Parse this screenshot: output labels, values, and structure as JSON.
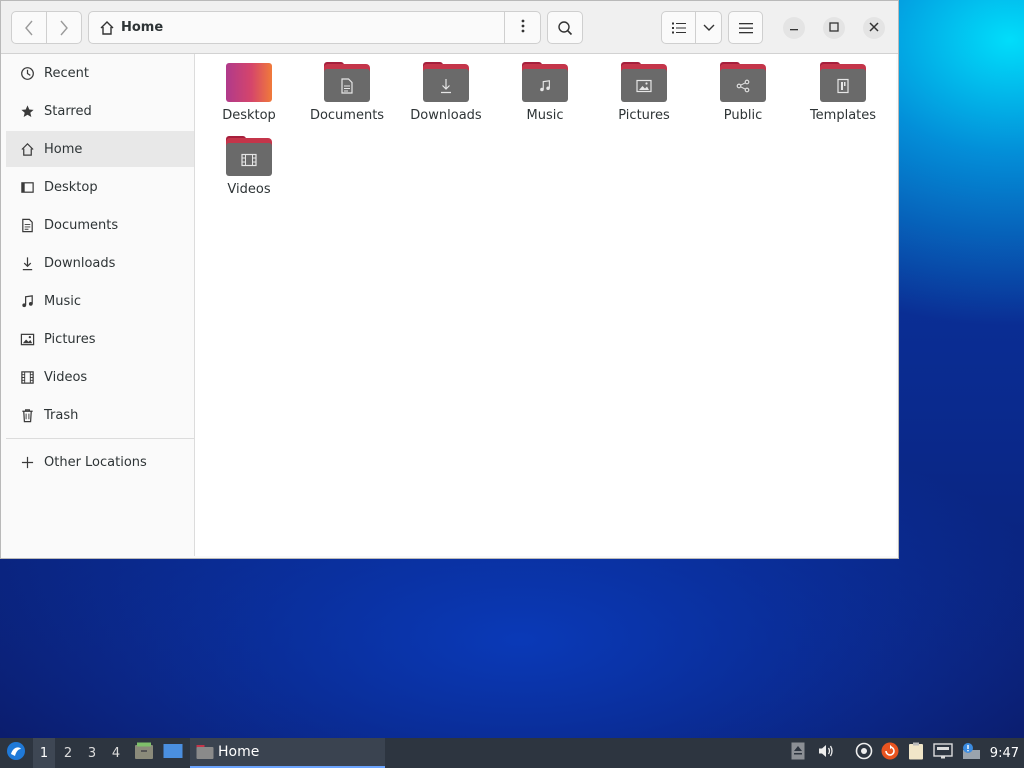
{
  "window": {
    "path_label": "Home"
  },
  "sidebar": {
    "items": [
      {
        "label": "Recent",
        "icon": "clock-icon"
      },
      {
        "label": "Starred",
        "icon": "star-icon"
      },
      {
        "label": "Home",
        "icon": "home-icon",
        "active": true
      },
      {
        "label": "Desktop",
        "icon": "desktop-icon"
      },
      {
        "label": "Documents",
        "icon": "document-icon"
      },
      {
        "label": "Downloads",
        "icon": "download-icon"
      },
      {
        "label": "Music",
        "icon": "music-icon"
      },
      {
        "label": "Pictures",
        "icon": "picture-icon"
      },
      {
        "label": "Videos",
        "icon": "video-icon"
      },
      {
        "label": "Trash",
        "icon": "trash-icon"
      }
    ],
    "other_locations": {
      "label": "Other Locations",
      "icon": "plus-icon"
    }
  },
  "content": {
    "folders": [
      {
        "label": "Desktop",
        "icon": "desktop-folder-icon"
      },
      {
        "label": "Documents",
        "icon": "document-folder-icon"
      },
      {
        "label": "Downloads",
        "icon": "download-folder-icon"
      },
      {
        "label": "Music",
        "icon": "music-folder-icon"
      },
      {
        "label": "Pictures",
        "icon": "picture-folder-icon"
      },
      {
        "label": "Public",
        "icon": "share-folder-icon"
      },
      {
        "label": "Templates",
        "icon": "template-folder-icon"
      },
      {
        "label": "Videos",
        "icon": "video-folder-icon"
      }
    ]
  },
  "taskbar": {
    "workspaces": [
      "1",
      "2",
      "3",
      "4"
    ],
    "active_workspace": "1",
    "task_label": "Home",
    "clock": "9:47"
  },
  "colors": {
    "accent": "#6ba4ff",
    "folder_tab": "#c4354a",
    "folder_body": "#6a6a6a",
    "taskbar": "#2d3540"
  }
}
